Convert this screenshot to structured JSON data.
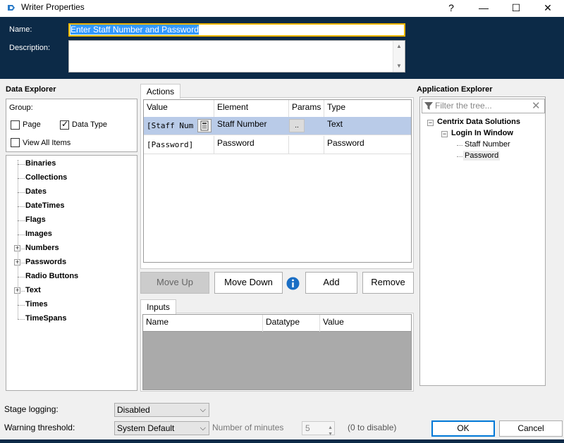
{
  "window": {
    "title": "Writer Properties",
    "help_label": "?",
    "minimize_label": "—",
    "maximize_label": "☐",
    "close_label": "✕"
  },
  "header": {
    "name_label": "Name:",
    "name_value": "Enter Staff Number and Password",
    "description_label": "Description:",
    "description_value": ""
  },
  "data_explorer": {
    "title": "Data Explorer",
    "group_label": "Group:",
    "page_label": "Page",
    "page_checked": false,
    "datatype_label": "Data Type",
    "datatype_checked": true,
    "view_all_label": "View All Items",
    "view_all_checked": false,
    "items": [
      {
        "label": "Binaries",
        "expandable": false
      },
      {
        "label": "Collections",
        "expandable": false
      },
      {
        "label": "Dates",
        "expandable": false
      },
      {
        "label": "DateTimes",
        "expandable": false
      },
      {
        "label": "Flags",
        "expandable": false
      },
      {
        "label": "Images",
        "expandable": false
      },
      {
        "label": "Numbers",
        "expandable": true
      },
      {
        "label": "Passwords",
        "expandable": true
      },
      {
        "label": "Radio Buttons",
        "expandable": false
      },
      {
        "label": "Text",
        "expandable": true
      },
      {
        "label": "Times",
        "expandable": false
      },
      {
        "label": "TimeSpans",
        "expandable": false
      }
    ]
  },
  "actions": {
    "tab_label": "Actions",
    "columns": [
      "Value",
      "Element",
      "Params",
      "Type"
    ],
    "rows": [
      {
        "value": "[Staff Num",
        "element": "Staff Number",
        "params": "..",
        "type": "Text",
        "selected": true
      },
      {
        "value": "[Password]",
        "element": "Password",
        "params": "",
        "type": "Password",
        "selected": false
      }
    ],
    "move_up_label": "Move Up",
    "move_down_label": "Move Down",
    "add_label": "Add",
    "remove_label": "Remove"
  },
  "inputs": {
    "tab_label": "Inputs",
    "columns": [
      "Name",
      "Datatype",
      "Value"
    ]
  },
  "app_explorer": {
    "title": "Application Explorer",
    "filter_placeholder": "Filter the tree...",
    "root": "Centrix Data Solutions",
    "child": "Login In Window",
    "leaves": [
      "Staff Number",
      "Password"
    ]
  },
  "bottom": {
    "stage_logging_label": "Stage logging:",
    "stage_logging_value": "Disabled",
    "warning_label": "Warning threshold:",
    "warning_value": "System Default",
    "minutes_label": "Number of minutes",
    "minutes_value": "5",
    "disable_hint": "(0 to disable)",
    "ok_label": "OK",
    "cancel_label": "Cancel"
  },
  "colors": {
    "header_band": "#0c2a47",
    "selection": "#b9cbe8",
    "focus_border": "#f0b400",
    "info_icon": "#1a6ec4"
  }
}
